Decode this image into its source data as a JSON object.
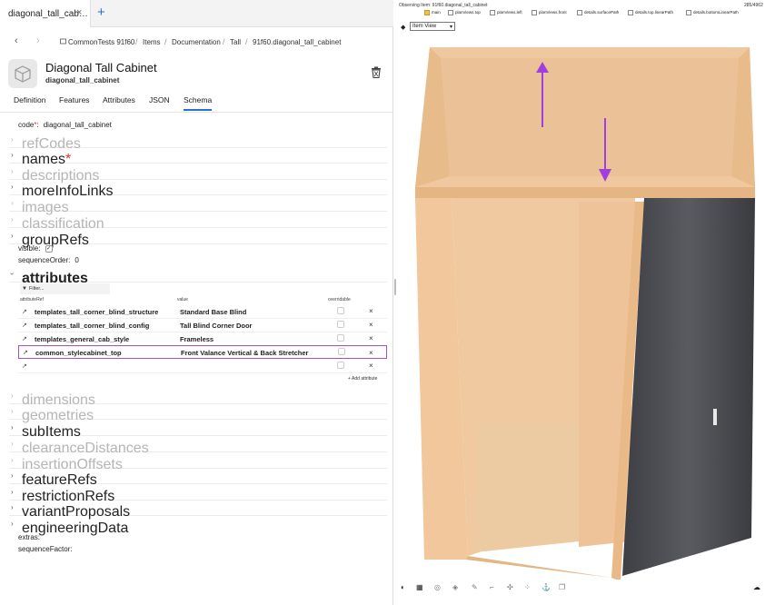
{
  "tabs": [
    {
      "label": "diagonal_tall_cab…",
      "close": "×"
    }
  ],
  "tab_add": "+",
  "breadcrumb": {
    "back": "‹",
    "forward": "›",
    "items": [
      "CommonTests 91f60",
      "Items",
      "Documentation",
      "Tall",
      "91f60.diagonal_tall_cabinet"
    ],
    "separator": "/"
  },
  "item": {
    "title": "Diagonal Tall Cabinet",
    "subtitle": "diagonal_tall_cabinet",
    "icon": "cube-icon"
  },
  "subtabs": [
    {
      "label": "Definition",
      "active": false
    },
    {
      "label": "Features",
      "active": false
    },
    {
      "label": "Attributes",
      "active": false
    },
    {
      "label": "JSON",
      "active": false
    },
    {
      "label": "Schema",
      "active": true
    }
  ],
  "schema": {
    "code": {
      "label": "code",
      "req": "*",
      "sep": ":",
      "value": "diagonal_tall_cabinet"
    },
    "rows_top": [
      {
        "label": "refCodes",
        "muted": true,
        "req": ""
      },
      {
        "label": "names",
        "muted": false,
        "req": "*"
      },
      {
        "label": "descriptions",
        "muted": true,
        "req": ""
      },
      {
        "label": "moreInfoLinks",
        "muted": false,
        "req": ""
      },
      {
        "label": "images",
        "muted": true,
        "req": ""
      },
      {
        "label": "classification",
        "muted": true,
        "req": ""
      },
      {
        "label": "groupRefs",
        "muted": false,
        "req": ""
      }
    ],
    "visible_label": "visible:",
    "visible_checked": true,
    "visible_check": "✓",
    "sequence_order_label": "sequenceOrder:",
    "sequence_order_value": "0",
    "attributes_label": "attributes",
    "filter_placeholder": "Filter...",
    "columns": {
      "ref": "attributeRef",
      "value": "value",
      "overridable": "overridable"
    },
    "attribute_rows": [
      {
        "ref": "templates_tall_corner_blind_structure",
        "value": "Standard Base Blind",
        "selected": false
      },
      {
        "ref": "templates_tall_corner_blind_config",
        "value": "Tall Blind Corner Door",
        "selected": false
      },
      {
        "ref": "templates_general_cab_style",
        "value": "Frameless",
        "selected": false
      },
      {
        "ref": "common_stylecabinet_top",
        "value": "Front Valance Vertical & Back Stretcher",
        "selected": true
      },
      {
        "ref": "",
        "value": "",
        "selected": false
      }
    ],
    "remove_glyph": "×",
    "add_attribute": "+ Add attribute",
    "rows_bottom": [
      {
        "label": "dimensions",
        "muted": true
      },
      {
        "label": "geometries",
        "muted": true
      },
      {
        "label": "subItems",
        "muted": false
      },
      {
        "label": "clearanceDistances",
        "muted": true
      },
      {
        "label": "insertionOffsets",
        "muted": true
      },
      {
        "label": "featureRefs",
        "muted": false
      },
      {
        "label": "restrictionRefs",
        "muted": false
      },
      {
        "label": "variantProposals",
        "muted": false
      },
      {
        "label": "engineeringData",
        "muted": false
      }
    ],
    "extras_label": "extras:",
    "sequence_factor_label": "sequenceFactor:"
  },
  "viewer": {
    "observing": "Observing Item: 91f60.diagonal_tall_cabinet",
    "size": "285/4962",
    "checkboxes": [
      {
        "label": "main",
        "checked": true
      },
      {
        "label": "planViews.top",
        "checked": false
      },
      {
        "label": "planViews.left",
        "checked": false
      },
      {
        "label": "planViews.front",
        "checked": false
      },
      {
        "label": "details.surfacePath",
        "checked": false
      },
      {
        "label": "details.top.linearPath",
        "checked": false
      },
      {
        "label": "details.bottomLinearPath",
        "checked": false
      }
    ],
    "view_mode": "Item View",
    "colors": {
      "wood": "#f2c9a0",
      "wood_dark": "#e0b084",
      "door": "#4c4d52",
      "arrow": "#a03fe0",
      "accent": "#2a6fd8",
      "selection": "#a84ec9"
    },
    "toolbar": [
      "palette-icon",
      "grid-icon",
      "circle-icon",
      "cube-icon",
      "brush-icon",
      "crop-icon",
      "target-icon",
      "dots-icon",
      "anchor-icon",
      "layers-icon"
    ],
    "download_icon": "cloud-download-icon"
  }
}
